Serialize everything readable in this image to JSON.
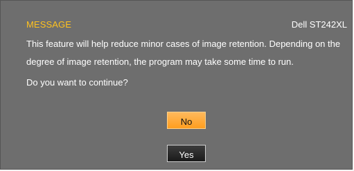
{
  "dialog": {
    "title": "MESSAGE",
    "model": "Dell ST242XL",
    "message_lines": [
      "This feature will help reduce minor cases of image retention. Depending on the",
      "degree of image retention, the program may take some time to run."
    ],
    "prompt": "Do you want to continue?",
    "buttons": {
      "no_label": "No",
      "yes_label": "Yes",
      "selected": "No"
    }
  },
  "colors": {
    "dialog_background": "#6e6e6e",
    "title_accent": "#ffc21f",
    "selected_button": "#ffa733",
    "unselected_button": "#2a2a2a"
  }
}
